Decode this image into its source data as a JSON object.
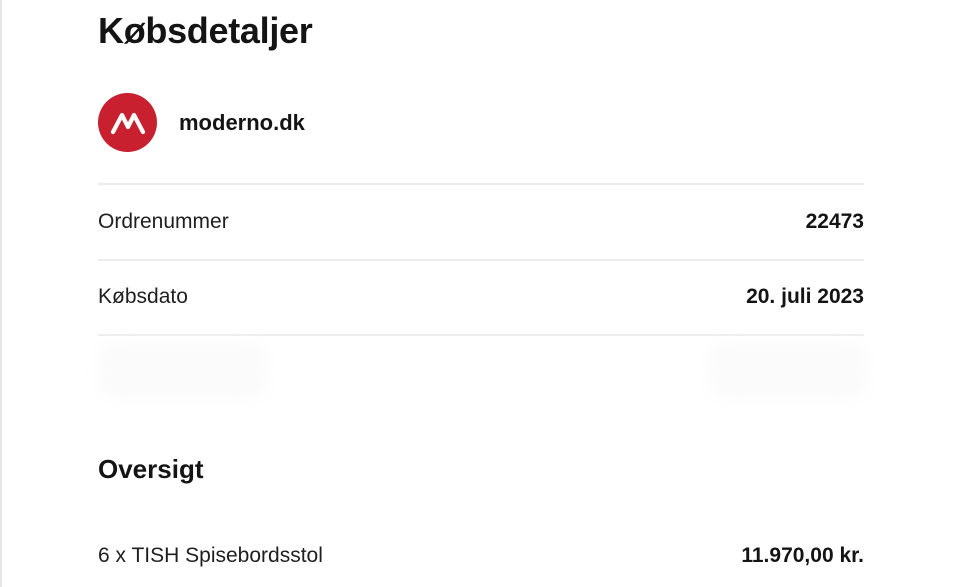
{
  "header": {
    "title": "Købsdetaljer"
  },
  "merchant": {
    "logo_icon": "moderno-logo-icon",
    "logo_color": "#c8202f",
    "name": "moderno.dk"
  },
  "details": [
    {
      "label": "Ordrenummer",
      "value": "22473"
    },
    {
      "label": "Købsdato",
      "value": "20. juli 2023"
    }
  ],
  "overview": {
    "title": "Oversigt",
    "items": [
      {
        "label": "6 x TISH Spisebordsstol",
        "value": "11.970,00 kr."
      }
    ]
  }
}
